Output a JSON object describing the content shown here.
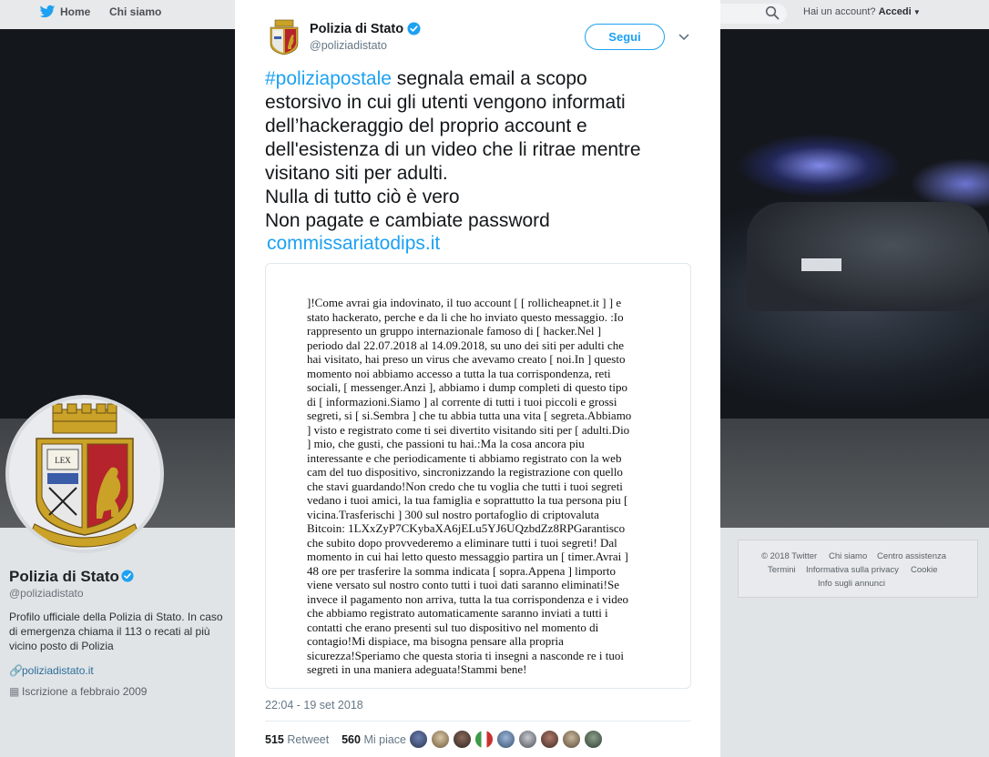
{
  "topnav": {
    "home": "Home",
    "about": "Chi siamo",
    "login_prompt": "Hai un account?",
    "login_link": "Accedi"
  },
  "profile": {
    "name": "Polizia di Stato",
    "handle": "@poliziadistato",
    "bio": "Profilo ufficiale della Polizia di Stato. In caso di emergenza chiama il 113 o recati al più vicino posto di Polizia",
    "website": "poliziadistato.it",
    "joined": "Iscrizione a febbraio 2009",
    "emblem_text": "LEX",
    "motto": "SUB LEGE LIBERTAS"
  },
  "footer": {
    "links": [
      "© 2018 Twitter",
      "Chi siamo",
      "Centro assistenza",
      "Termini",
      "Informativa sulla privacy",
      "Cookie",
      "Info sugli annunci"
    ]
  },
  "tweet": {
    "author_name": "Polizia di Stato",
    "author_handle": "@poliziadistato",
    "follow_label": "Segui",
    "hashtag": "#poliziapostale",
    "text_lines": [
      " segnala email a scopo",
      "estorsivo in cui gli utenti vengono informati",
      "dell’hackeraggio del proprio account e",
      "dell'esistenza di un video che li ritrae mentre",
      "visitano siti per adulti.",
      "Nulla di tutto ciò è vero",
      "Non pagate e cambiate password"
    ],
    "link": "commissariatodips.it",
    "image_text": "]!Come avrai gia indovinato, il tuo account [ [ rollicheapnet.it ] ] e\nstato hackerato, perche e da li che ho inviato questo messaggio. :Io\nrappresento un gruppo internazionale famoso di [ hacker.Nel ]\nperiodo dal 22.07.2018 al 14.09.2018, su uno dei siti per adulti che\nhai visitato, hai preso un virus che avevamo creato [ noi.In ] questo\nmomento noi abbiamo accesso a tutta la tua corrispondenza, reti\nsociali, [ messenger.Anzi ], abbiamo i dump completi di questo tipo\ndi [ informazioni.Siamo ] al corrente di tutti i tuoi piccoli e grossi\nsegreti, si [ si.Sembra ] che tu abbia tutta una vita [ segreta.Abbiamo\n] visto e registrato come ti sei divertito visitando siti per [ adulti.Dio\n] mio, che gusti, che passioni tu hai.:Ma la cosa ancora piu\ninteressante e che periodicamente ti abbiamo registrato con la web\ncam del tuo dispositivo, sincronizzando la registrazione con quello\nche stavi guardando!Non credo che tu voglia che tutti i tuoi segreti\nvedano i tuoi amici, la tua famiglia e soprattutto la tua persona piu [\nvicina.Trasferischi ] 300 sul nostro portafoglio di criptovaluta\nBitcoin: 1LXxZyP7CKybaXA6jELu5YJ6UQzbdZz8RPGarantisco\nche subito dopo provvederemo a eliminare tutti i tuoi segreti! Dal\nmomento in cui hai letto questo messaggio partira un [ timer.Avrai ]\n48 ore per trasferire la somma indicata [ sopra.Appena ] limporto\nviene versato sul nostro conto tutti i tuoi dati saranno eliminati!Se\ninvece il pagamento non arriva, tutta la tua corrispondenza e i video\nche abbiamo registrato automaticamente saranno inviati a tutti i\ncontatti che erano presenti sul tuo dispositivo nel momento di\ncontagio!Mi dispiace, ma bisogna pensare alla propria\nsicurezza!Speriamo che questa storia ti insegni a nasconde re i tuoi\nsegreti in una maniera adeguata!Stammi bene!",
    "timestamp": "22:04 - 19 set 2018",
    "retweets": "515",
    "retweets_label": "Retweet",
    "likes": "560",
    "likes_label": "Mi piace"
  },
  "colors": {
    "accent": "#1da1f2",
    "emblem_red": "#b5232c",
    "emblem_gold": "#c9a227"
  }
}
